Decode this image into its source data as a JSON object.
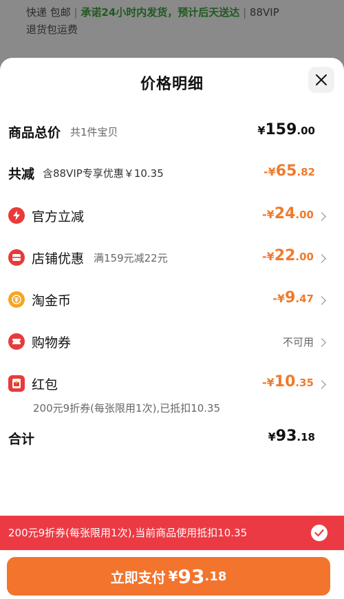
{
  "background": {
    "line1_left": "快递 包邮",
    "line1_sep": "|",
    "line1_promise": "承诺24小时内发货，预计后天送达",
    "line1_vip": "88VIP",
    "line2": "退货包运费"
  },
  "sheet": {
    "title": "价格明细",
    "close_icon": "close-icon"
  },
  "total_goods": {
    "label": "商品总价",
    "sub": "共1件宝贝",
    "yen": "¥",
    "int": "159",
    "dec": ".00"
  },
  "reduction": {
    "label": "共减",
    "sub": "含88VIP专享优惠￥10.35",
    "prefix": "-¥",
    "int": "65",
    "dec": ".82"
  },
  "items": [
    {
      "icon": "lightning-icon",
      "label": "官方立减",
      "sub": "",
      "prefix": "-¥",
      "int": "24",
      "dec": ".00"
    },
    {
      "icon": "store-icon",
      "label": "店铺优惠",
      "sub": "满159元减22元",
      "prefix": "-¥",
      "int": "22",
      "dec": ".00"
    },
    {
      "icon": "coin-icon",
      "label": "淘金币",
      "sub": "",
      "prefix": "-¥",
      "int": "9",
      "dec": ".47"
    },
    {
      "icon": "coupon-icon",
      "label": "购物券",
      "status": "不可用"
    },
    {
      "icon": "red-packet-icon",
      "label": "红包",
      "note": "200元9折券(每张限用1次),已抵扣10.35",
      "prefix": "-¥",
      "int": "10",
      "dec": ".35"
    }
  ],
  "sum": {
    "label": "合计",
    "yen": "¥",
    "int": "93",
    "dec": ".18"
  },
  "banner": {
    "text": "200元9折券(每张限用1次),当前商品使用抵扣10.35",
    "check_icon": "check-circle-icon"
  },
  "pay": {
    "label": "立即支付",
    "yen": "¥",
    "int": "93",
    "dec": ".18"
  },
  "colors": {
    "accent_orange": "#f07a2c",
    "banner_red": "#ec3a44",
    "icon_red": "#e83a3a"
  }
}
